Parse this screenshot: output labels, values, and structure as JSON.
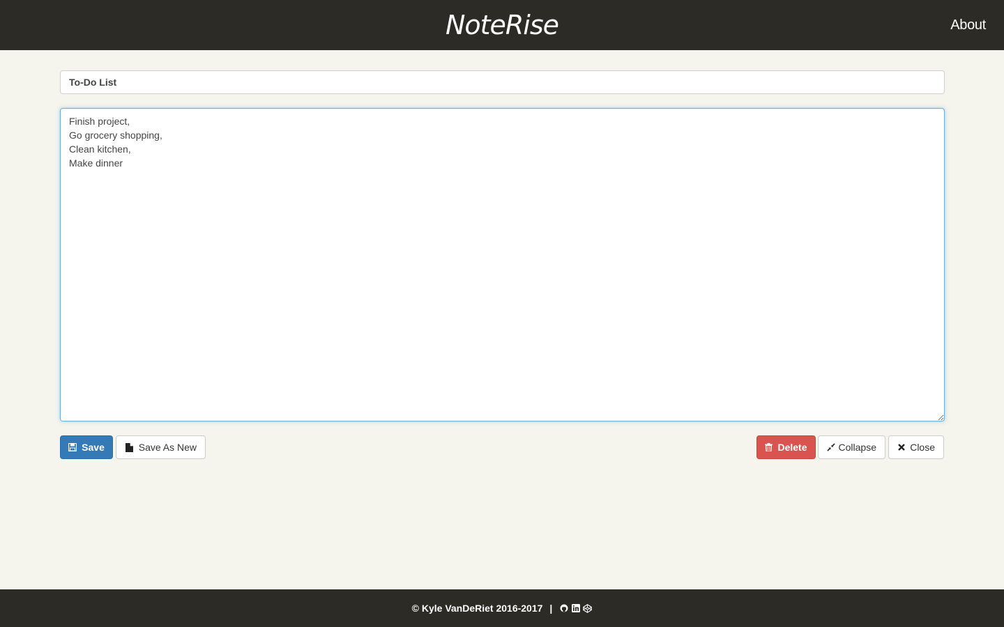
{
  "header": {
    "brand": "NoteRise",
    "about_label": "About"
  },
  "note": {
    "title_value": "To-Do List",
    "body_value": "Finish project,\nGo grocery shopping,\nClean kitchen,\nMake dinner"
  },
  "actions": {
    "save_label": "Save",
    "save_as_new_label": "Save As New",
    "delete_label": "Delete",
    "collapse_label": "Collapse",
    "close_label": "Close"
  },
  "footer": {
    "copyright": "© Kyle VanDeRiet 2016-2017",
    "separator": "|",
    "icons": [
      "github-icon",
      "linkedin-icon",
      "codepen-icon"
    ]
  },
  "colors": {
    "navbar_bg": "#2c2b26",
    "page_bg": "#f5f4ed",
    "primary": "#337ab7",
    "danger": "#d9534f",
    "focus_border": "#66afe9"
  }
}
